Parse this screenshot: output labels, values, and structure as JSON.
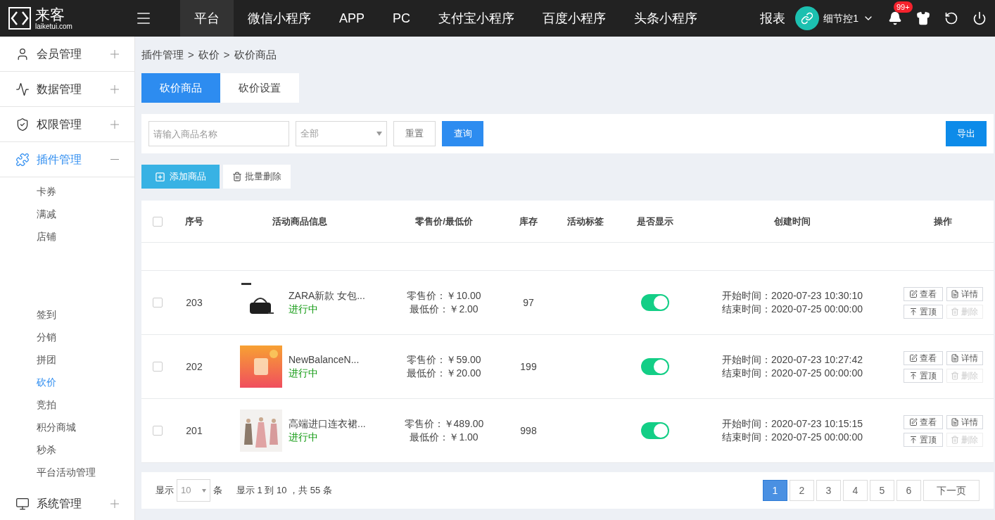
{
  "header": {
    "logo": {
      "name": "来客",
      "domain": "laiketui.com"
    },
    "nav": [
      {
        "label": "平台",
        "selected": true
      },
      {
        "label": "微信小程序",
        "selected": false
      },
      {
        "label": "APP",
        "selected": false
      },
      {
        "label": "PC",
        "selected": false
      },
      {
        "label": "支付宝小程序",
        "selected": false
      },
      {
        "label": "百度小程序",
        "selected": false
      },
      {
        "label": "头条小程序",
        "selected": false
      }
    ],
    "report": "报表",
    "user": "细节控1",
    "badge": "99+"
  },
  "sidebar": {
    "items": [
      {
        "label": "会员管理",
        "expanded": false
      },
      {
        "label": "数据管理",
        "expanded": false
      },
      {
        "label": "权限管理",
        "expanded": false
      },
      {
        "label": "插件管理",
        "expanded": true,
        "children_top": [
          {
            "label": "卡券",
            "selected": false
          },
          {
            "label": "满减",
            "selected": false
          },
          {
            "label": "店铺",
            "selected": false
          }
        ],
        "children": [
          {
            "label": "签到",
            "selected": false
          },
          {
            "label": "分销",
            "selected": false
          },
          {
            "label": "拼团",
            "selected": false
          },
          {
            "label": "砍价",
            "selected": true
          },
          {
            "label": "竞拍",
            "selected": false
          },
          {
            "label": "积分商城",
            "selected": false
          },
          {
            "label": "秒杀",
            "selected": false
          },
          {
            "label": "平台活动管理",
            "selected": false
          }
        ]
      },
      {
        "label": "系统管理",
        "expanded": false
      }
    ]
  },
  "breadcrumb": [
    "插件管理",
    "砍价",
    "砍价商品"
  ],
  "breadcrumb_separator": ">",
  "tabs": [
    {
      "label": "砍价商品",
      "selected": true
    },
    {
      "label": "砍价设置",
      "selected": false
    }
  ],
  "filter": {
    "search": {
      "placeholder": "请输入商品名称"
    },
    "select": {
      "value": "全部"
    },
    "reset": "重置",
    "query": "查询",
    "export": "导出"
  },
  "actions": {
    "add": "添加商品",
    "batch_delete": "批量删除"
  },
  "table": {
    "select_all_checked": false,
    "columns": [
      "序号",
      "活动商品信息",
      "零售价/最低价",
      "库存",
      "活动标签",
      "是否显示",
      "创建时间",
      "操作"
    ],
    "rows": [
      {
        "id": "203",
        "name": "ZARA新款 女包...",
        "status": "进行中",
        "retail": "零售价：￥10.00",
        "lowest": "最低价：￥2.00",
        "stock": "97",
        "shown": true,
        "start": "开始时间：2020-07-23 10:30:10",
        "end": "结束时间：2020-07-25 00:00:00",
        "checked": false,
        "actions": [
          {
            "label": "查看",
            "disabled": false
          },
          {
            "label": "详情",
            "disabled": false
          },
          {
            "label": "置顶",
            "disabled": false
          },
          {
            "label": "删除",
            "disabled": true
          }
        ]
      },
      {
        "id": "202",
        "name": "NewBalanceN...",
        "status": "进行中",
        "retail": "零售价：￥59.00",
        "lowest": "最低价：￥20.00",
        "stock": "199",
        "shown": true,
        "start": "开始时间：2020-07-23 10:27:42",
        "end": "结束时间：2020-07-25 00:00:00",
        "checked": false,
        "actions": [
          {
            "label": "查看",
            "disabled": false
          },
          {
            "label": "详情",
            "disabled": false
          },
          {
            "label": "置顶",
            "disabled": false
          },
          {
            "label": "删除",
            "disabled": true
          }
        ]
      },
      {
        "id": "201",
        "name": "高端进口连衣裙...",
        "status": "进行中",
        "retail": "零售价：￥489.00",
        "lowest": "最低价：￥1.00",
        "stock": "998",
        "shown": true,
        "start": "开始时间：2020-07-23 10:15:15",
        "end": "结束时间：2020-07-25 00:00:00",
        "checked": false,
        "actions": [
          {
            "label": "查看",
            "disabled": false
          },
          {
            "label": "详情",
            "disabled": false
          },
          {
            "label": "置顶",
            "disabled": false
          },
          {
            "label": "删除",
            "disabled": true
          }
        ]
      }
    ]
  },
  "pagination": {
    "show": "显示",
    "per_page": "10",
    "unit": "条",
    "summary": "显示 1 到 10 ，共 55 条",
    "pages": [
      {
        "label": "1",
        "selected": true
      },
      {
        "label": "2",
        "selected": false
      },
      {
        "label": "3",
        "selected": false
      },
      {
        "label": "4",
        "selected": false
      },
      {
        "label": "5",
        "selected": false
      },
      {
        "label": "6",
        "selected": false
      }
    ],
    "next": "下一页"
  }
}
